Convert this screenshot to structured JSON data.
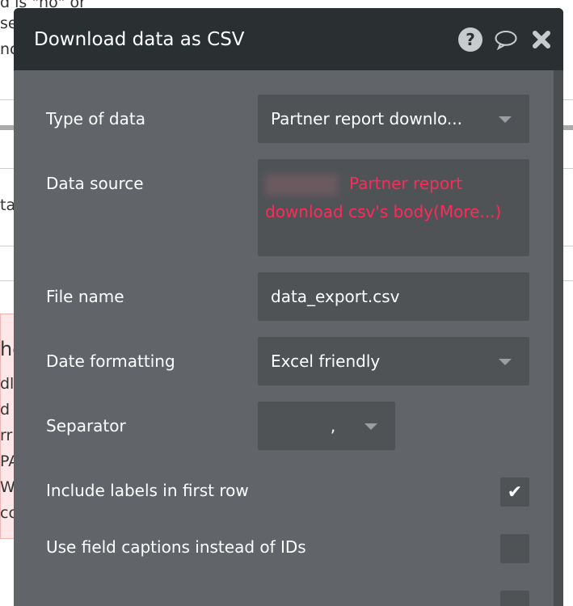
{
  "background": {
    "fragments": [
      "d is \"no\" or",
      "se",
      "nc",
      "ta",
      "he",
      "dl",
      "d",
      "rr",
      "PA",
      "W",
      "cc"
    ]
  },
  "dialog": {
    "title": "Download data as CSV",
    "icons": [
      "help-icon",
      "comment-icon",
      "close-icon"
    ],
    "fields": {
      "type_of_data": {
        "label": "Type of data",
        "value": "Partner report downlo..."
      },
      "data_source": {
        "label": "Data source",
        "value": "Partner report download csv's body(More...)"
      },
      "file_name": {
        "label": "File name",
        "value": "data_export.csv"
      },
      "date_formatting": {
        "label": "Date formatting",
        "value": "Excel friendly"
      },
      "separator": {
        "label": "Separator",
        "value": ","
      },
      "include_labels": {
        "label": "Include labels in first row",
        "checked": true
      },
      "use_captions": {
        "label": "Use field captions instead of IDs",
        "checked": false
      }
    }
  },
  "colors": {
    "header": "#2a3032",
    "body": "#616569",
    "input": "#505356",
    "expression": "#ff2a5a"
  }
}
